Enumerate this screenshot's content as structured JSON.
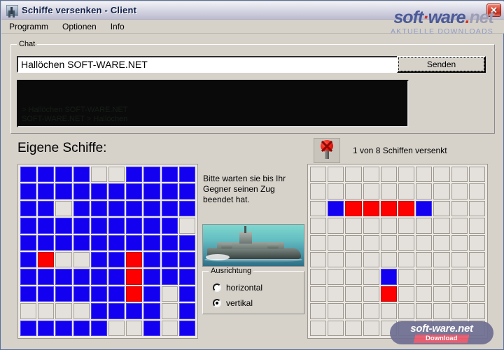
{
  "window": {
    "title": "Schiffe versenken - Client",
    "icon": "battleship-icon",
    "close_label": "✕"
  },
  "menu": {
    "items": [
      {
        "label": "Programm"
      },
      {
        "label": "Optionen"
      },
      {
        "label": "Info"
      }
    ]
  },
  "brand": {
    "soft": "soft",
    "dot": "·",
    "ware": "ware",
    "period": ".",
    "net": "net",
    "subtitle": "AKTUELLE DOWNLOADS"
  },
  "chat": {
    "group_label": "Chat",
    "input_value": "Hallöchen SOFT-WARE.NET",
    "input_placeholder": "",
    "send_label": "Senden",
    "log_lines": [
      "> Hallöchen SOFT-WARE.NET",
      "SOFT-WARE.NET > Hallöchen"
    ]
  },
  "game": {
    "own_title": "Eigene Schiffe:",
    "mine_icon": "sea-mine-icon",
    "status": "1 von 8 Schiffen versenkt",
    "hint": "Bitte warten sie bis Ihr Gegner seinen Zug beendet hat.",
    "ship_photo_alt": "battleship-photo",
    "orientation": {
      "group_label": "Ausrichtung",
      "options": [
        {
          "label": "horizontal",
          "selected": false
        },
        {
          "label": "vertikal",
          "selected": true
        }
      ]
    },
    "own_board": [
      [
        "ship",
        "ship",
        "ship",
        "ship",
        "empty",
        "empty",
        "ship",
        "ship",
        "ship",
        "ship"
      ],
      [
        "ship",
        "ship",
        "ship",
        "ship",
        "ship",
        "ship",
        "ship",
        "ship",
        "ship",
        "ship"
      ],
      [
        "ship",
        "ship",
        "empty",
        "ship",
        "ship",
        "ship",
        "ship",
        "ship",
        "ship",
        "ship"
      ],
      [
        "ship",
        "ship",
        "ship",
        "ship",
        "ship",
        "ship",
        "ship",
        "ship",
        "ship",
        "empty"
      ],
      [
        "ship",
        "ship",
        "ship",
        "ship",
        "ship",
        "ship",
        "ship",
        "ship",
        "ship",
        "ship"
      ],
      [
        "ship",
        "hit",
        "empty",
        "empty",
        "ship",
        "ship",
        "hit",
        "ship",
        "ship",
        "ship"
      ],
      [
        "ship",
        "ship",
        "ship",
        "ship",
        "ship",
        "ship",
        "hit",
        "ship",
        "ship",
        "ship"
      ],
      [
        "ship",
        "ship",
        "ship",
        "ship",
        "ship",
        "ship",
        "hit",
        "ship",
        "empty",
        "ship"
      ],
      [
        "empty",
        "empty",
        "empty",
        "empty",
        "ship",
        "ship",
        "ship",
        "ship",
        "empty",
        "ship"
      ],
      [
        "ship",
        "ship",
        "ship",
        "ship",
        "ship",
        "empty",
        "empty",
        "ship",
        "empty",
        "ship"
      ]
    ],
    "enemy_board": [
      [
        "empty",
        "empty",
        "empty",
        "empty",
        "empty",
        "empty",
        "empty",
        "empty",
        "empty",
        "empty"
      ],
      [
        "empty",
        "empty",
        "empty",
        "empty",
        "empty",
        "empty",
        "empty",
        "empty",
        "empty",
        "empty"
      ],
      [
        "empty",
        "ship",
        "hit",
        "hit",
        "hit",
        "hit",
        "ship",
        "empty",
        "empty",
        "empty"
      ],
      [
        "empty",
        "empty",
        "empty",
        "empty",
        "empty",
        "empty",
        "empty",
        "empty",
        "empty",
        "empty"
      ],
      [
        "empty",
        "empty",
        "empty",
        "empty",
        "empty",
        "empty",
        "empty",
        "empty",
        "empty",
        "empty"
      ],
      [
        "empty",
        "empty",
        "empty",
        "empty",
        "empty",
        "empty",
        "empty",
        "empty",
        "empty",
        "empty"
      ],
      [
        "empty",
        "empty",
        "empty",
        "empty",
        "ship",
        "empty",
        "empty",
        "empty",
        "empty",
        "empty"
      ],
      [
        "empty",
        "empty",
        "empty",
        "empty",
        "hit",
        "empty",
        "empty",
        "empty",
        "empty",
        "empty"
      ],
      [
        "empty",
        "empty",
        "empty",
        "empty",
        "empty",
        "empty",
        "empty",
        "empty",
        "empty",
        "empty"
      ],
      [
        "empty",
        "empty",
        "empty",
        "empty",
        "empty",
        "empty",
        "empty",
        "empty",
        "empty",
        "empty"
      ]
    ]
  },
  "watermark": {
    "top": "soft-ware.net",
    "bottom": "Download"
  },
  "colors": {
    "ship": "#1400f0",
    "hit": "#ff0000",
    "empty": "#e4e1dc",
    "brand": "#4b5a98",
    "accent_red": "#d0332e"
  }
}
